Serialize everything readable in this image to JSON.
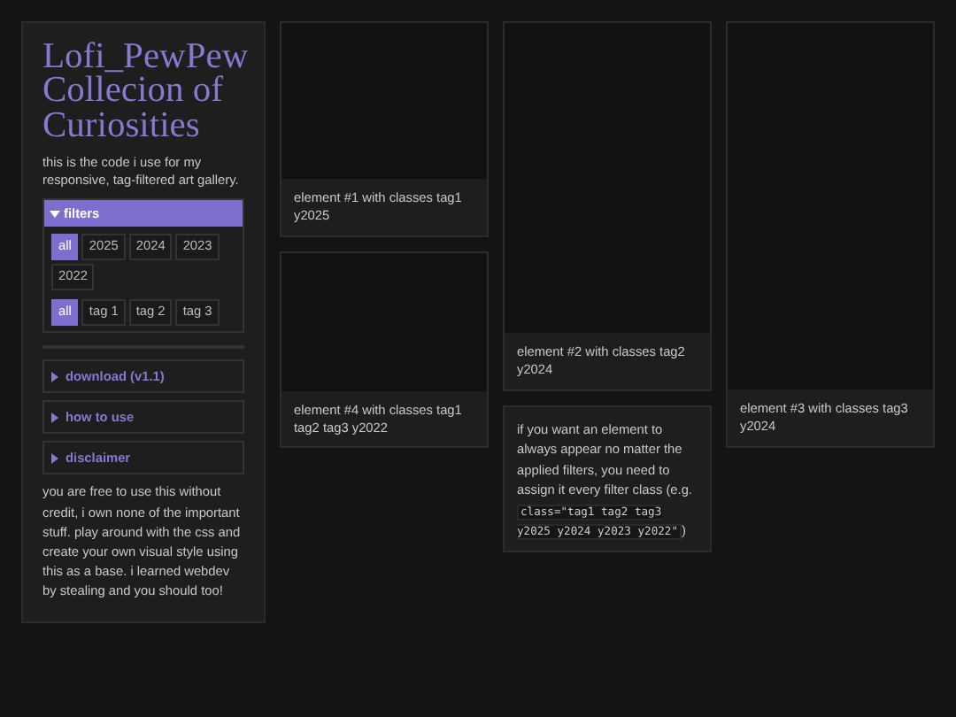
{
  "sidebar": {
    "title": "Lofi_PewPew Collecion of Curiosities",
    "description": "this is the code i use for my responsive, tag-filtered art gallery.",
    "filters": {
      "label": "filters",
      "expanded": true,
      "years": [
        {
          "label": "all",
          "selected": true
        },
        {
          "label": "2025",
          "selected": false
        },
        {
          "label": "2024",
          "selected": false
        },
        {
          "label": "2023",
          "selected": false
        },
        {
          "label": "2022",
          "selected": false
        }
      ],
      "tags": [
        {
          "label": "all",
          "selected": true
        },
        {
          "label": "tag 1",
          "selected": false
        },
        {
          "label": "tag 2",
          "selected": false
        },
        {
          "label": "tag 3",
          "selected": false
        }
      ]
    },
    "sections": [
      {
        "label": "download (v1.1)",
        "expanded": false
      },
      {
        "label": "how to use",
        "expanded": false
      },
      {
        "label": "disclaimer",
        "expanded": false
      }
    ],
    "footer_text": "you are free to use this without credit, i own none of the important stuff. play around with the css and create your own visual style using this as a base. i learned webdev by stealing and you should too!"
  },
  "gallery": {
    "columns": [
      [
        {
          "kind": "element",
          "caption": "element #1 with classes tag1 y2025"
        },
        {
          "kind": "element",
          "caption": "element #4 with classes tag1 tag2 tag3 y2022"
        }
      ],
      [
        {
          "kind": "element",
          "caption": "element #2 with classes tag2 y2024"
        },
        {
          "kind": "note",
          "text": "if you want an element to always appear no matter the applied filters, you need to assign it every filter class (e.g.",
          "code": "class=\"tag1 tag2 tag3 y2025 y2024 y2023 y2022\"",
          "text_after": ")"
        }
      ],
      [
        {
          "kind": "element",
          "caption": "element #3 with classes tag3 y2024"
        }
      ]
    ]
  }
}
